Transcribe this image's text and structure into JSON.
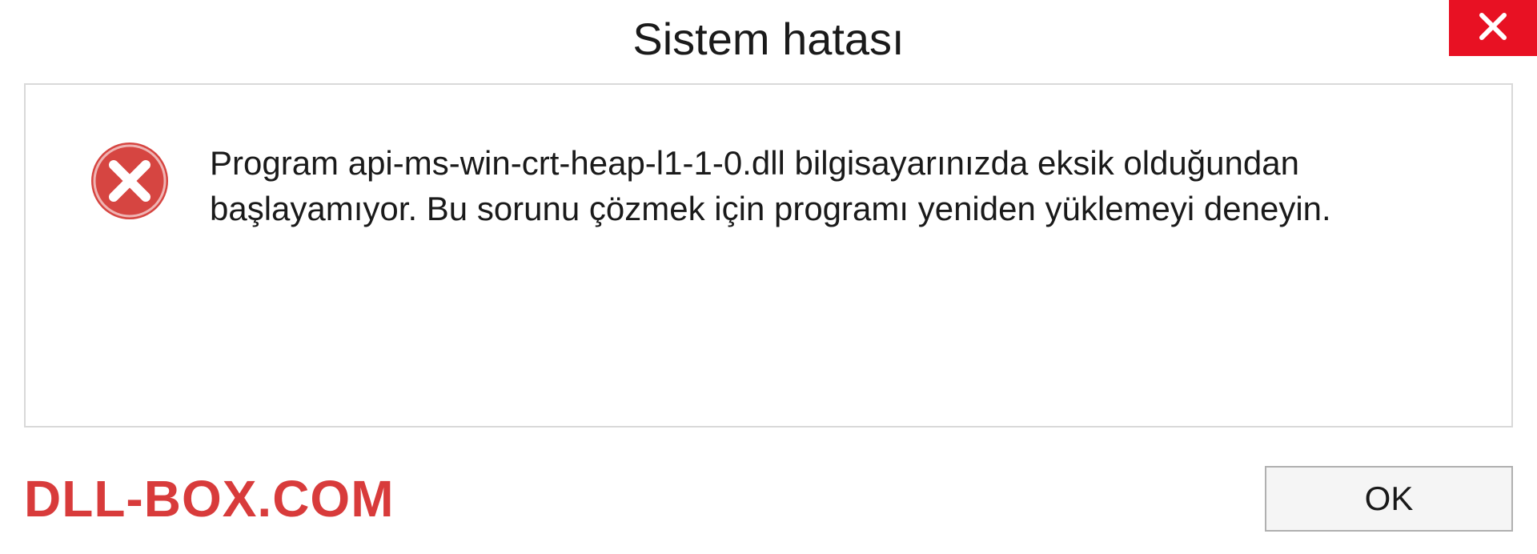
{
  "titlebar": {
    "title": "Sistem hatası"
  },
  "dialog": {
    "message": "Program api-ms-win-crt-heap-l1-1-0.dll bilgisayarınızda eksik olduğundan başlayamıyor. Bu sorunu çözmek için programı yeniden yüklemeyi deneyin."
  },
  "footer": {
    "watermark": "DLL-BOX.COM",
    "ok_label": "OK"
  },
  "colors": {
    "close_bg": "#e81123",
    "watermark": "#d83b3b",
    "error_icon": "#d64541"
  }
}
